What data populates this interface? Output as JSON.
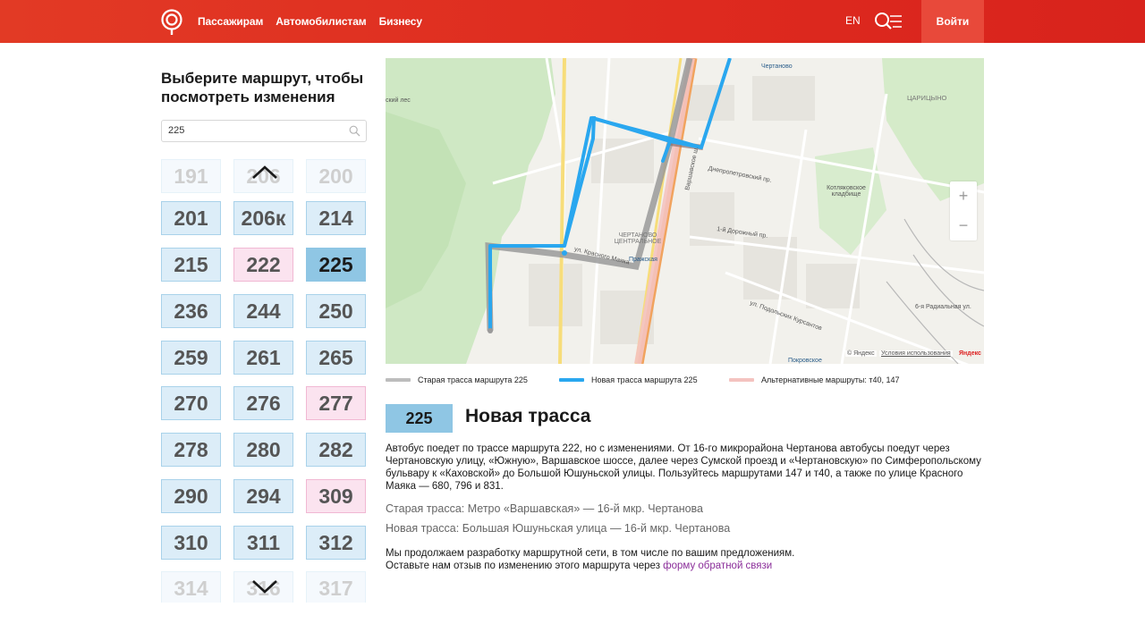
{
  "header": {
    "nav": [
      "Пассажирам",
      "Автомобилистам",
      "Бизнесу"
    ],
    "lang": "EN",
    "login": "Войти",
    "colors": {
      "header_bg": "#e02f22",
      "login_bg": "#e8493a"
    }
  },
  "left": {
    "title": "Выберите маршрут, чтобы посмотреть изменения",
    "search_value": "225",
    "routes": [
      {
        "n": "191",
        "style": "fade"
      },
      {
        "n": "206",
        "style": "fade"
      },
      {
        "n": "200",
        "style": "fade"
      },
      {
        "n": "201",
        "style": "blue"
      },
      {
        "n": "206к",
        "style": "blue"
      },
      {
        "n": "214",
        "style": "blue"
      },
      {
        "n": "215",
        "style": "blue"
      },
      {
        "n": "222",
        "style": "pink"
      },
      {
        "n": "225",
        "style": "active"
      },
      {
        "n": "236",
        "style": "blue"
      },
      {
        "n": "244",
        "style": "blue"
      },
      {
        "n": "250",
        "style": "blue"
      },
      {
        "n": "259",
        "style": "blue"
      },
      {
        "n": "261",
        "style": "blue"
      },
      {
        "n": "265",
        "style": "blue"
      },
      {
        "n": "270",
        "style": "blue"
      },
      {
        "n": "276",
        "style": "blue"
      },
      {
        "n": "277",
        "style": "pink"
      },
      {
        "n": "278",
        "style": "blue"
      },
      {
        "n": "280",
        "style": "blue"
      },
      {
        "n": "282",
        "style": "blue"
      },
      {
        "n": "290",
        "style": "blue"
      },
      {
        "n": "294",
        "style": "blue"
      },
      {
        "n": "309",
        "style": "pink"
      },
      {
        "n": "310",
        "style": "blue"
      },
      {
        "n": "311",
        "style": "blue"
      },
      {
        "n": "312",
        "style": "blue"
      },
      {
        "n": "314",
        "style": "fade"
      },
      {
        "n": "316",
        "style": "fade"
      },
      {
        "n": "317",
        "style": "fade"
      }
    ],
    "colors": {
      "tile_blue": "#dcedf8",
      "tile_pink": "#fbe3ef",
      "tile_active": "#8fc6e4"
    }
  },
  "map": {
    "labels": {
      "park": "ский лес",
      "chertanovo": "Чертаново",
      "tsaritsyno": "ЦАРИЦЫНО",
      "kotlyakovskoe": "Котляковское кладбище",
      "district": "ЧЕРТАНОВО ЦЕНТРАЛЬНОЕ",
      "krasny_mayak": "ул. Красного Маяка",
      "prazhskaya": "Пражская",
      "varshavskoe": "Варшавское ш.",
      "dnepropetrovsky": "Днепропетровский пр.",
      "dorozhny": "1-й Дорожный пр.",
      "podolskikh": "ул. Подольских Курсантов",
      "radialnaya": "6-я Радиальная ул.",
      "pokrovskoe": "Покровское",
      "yandex": "© Яндекс",
      "terms": "Условия использования",
      "yandex_logo": "Яндекс"
    },
    "zoom_in": "+",
    "zoom_out": "−",
    "colors": {
      "old_route": "#bdbdbd",
      "new_route": "#2aa7ef",
      "alt_route": "#f4c3c0"
    }
  },
  "legend": {
    "old": "Старая трасса маршрута 225",
    "new": "Новая трасса маршрута 225",
    "alt": "Альтернативные маршруты: т40, 147"
  },
  "detail": {
    "badge": "225",
    "title": "Новая трасса",
    "description": "Автобус поедет по трассе маршрута 222, но с изменениями. От 16-го микрорайона Чертанова автобусы поедут через Чертановскую улицу, «Южную», Варшавское шоссе, далее через Сумской проезд и «Чертановскую» по Симферопольскому бульвару к «Каховской» до Большой Юшуньской улицы. Пользуйтесь маршрутами 147 и т40, а также по улице Красного Маяка — 680, 796 и 831.",
    "old_route": "Старая трасса: Метро «Варшавская» — 16-й мкр. Чертанова",
    "new_route": "Новая трасса: Большая Юшуньская улица — 16-й мкр. Чертанова",
    "footer_line1": "Мы продолжаем разработку маршрутной сети, в том числе по вашим предложениям.",
    "footer_line2": "Оставьте нам отзыв по изменению этого маршрута через",
    "footer_link": "форму обратной связи"
  }
}
